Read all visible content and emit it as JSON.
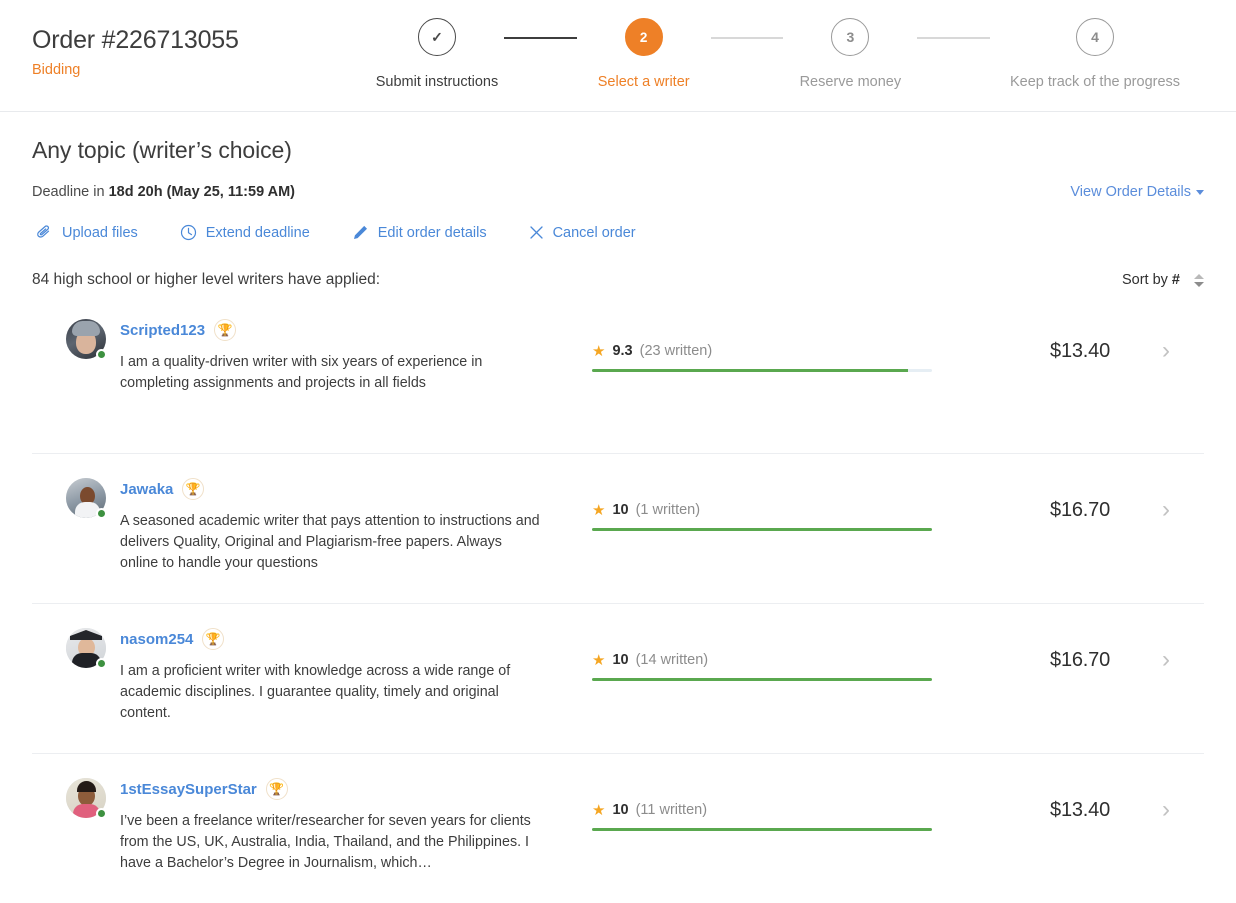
{
  "header": {
    "order_title": "Order #226713055",
    "order_status": "Bidding",
    "steps": [
      {
        "marker": "✓",
        "label": "Submit instructions",
        "state": "done"
      },
      {
        "marker": "2",
        "label": "Select a writer",
        "state": "current"
      },
      {
        "marker": "3",
        "label": "Reserve money",
        "state": "upcoming"
      },
      {
        "marker": "4",
        "label": "Keep track of the progress",
        "state": "upcoming"
      }
    ]
  },
  "order": {
    "topic": "Any topic (writer’s choice)",
    "deadline_prefix": "Deadline in",
    "deadline_value": "18d 20h",
    "deadline_date": "(May 25, 11:59 AM)",
    "view_details": "View Order Details"
  },
  "actions": [
    {
      "icon": "paperclip-icon",
      "label": "Upload files"
    },
    {
      "icon": "clock-icon",
      "label": "Extend deadline"
    },
    {
      "icon": "pencil-icon",
      "label": "Edit order details"
    },
    {
      "icon": "close-icon",
      "label": "Cancel order"
    }
  ],
  "list": {
    "applied_text": "84 high school or higher level writers have applied:",
    "sort_label": "Sort by",
    "sort_value": "#"
  },
  "writers": [
    {
      "name": "Scripted123",
      "badge": "trophy-icon",
      "bio": "I am a quality-driven writer with six years of experience in completing assignments and projects in all fields",
      "rating": "9.3",
      "written": "(23 written)",
      "rating_pct": 93,
      "price": "$13.40",
      "online": true
    },
    {
      "name": "Jawaka",
      "badge": "trophy-icon",
      "bio": "A seasoned academic writer that pays attention to instructions and delivers Quality, Original and Plagiarism-free papers. Always online to handle your questions",
      "rating": "10",
      "written": "(1 written)",
      "rating_pct": 100,
      "price": "$16.70",
      "online": true
    },
    {
      "name": "nasom254",
      "badge": "trophy-icon",
      "bio": "I am a proficient writer with knowledge across a wide range of academic disciplines. I guarantee quality, timely and original content.",
      "rating": "10",
      "written": "(14 written)",
      "rating_pct": 100,
      "price": "$16.70",
      "online": true
    },
    {
      "name": "1stEssaySuperStar",
      "badge": "trophy-icon",
      "bio": "I’ve been a freelance writer/researcher for seven years for clients from the US, UK, Australia, India, Thailand, and the Philippines. I have a Bachelor’s Degree in Journalism, which…",
      "rating": "10",
      "written": "(11 written)",
      "rating_pct": 100,
      "price": "$13.40",
      "online": true
    }
  ],
  "colors": {
    "accent_orange": "#ee8027",
    "link_blue": "#4a88d8",
    "rating_green": "#5aa84f",
    "star_gold": "#f5a623",
    "online_green": "#3d9140"
  }
}
